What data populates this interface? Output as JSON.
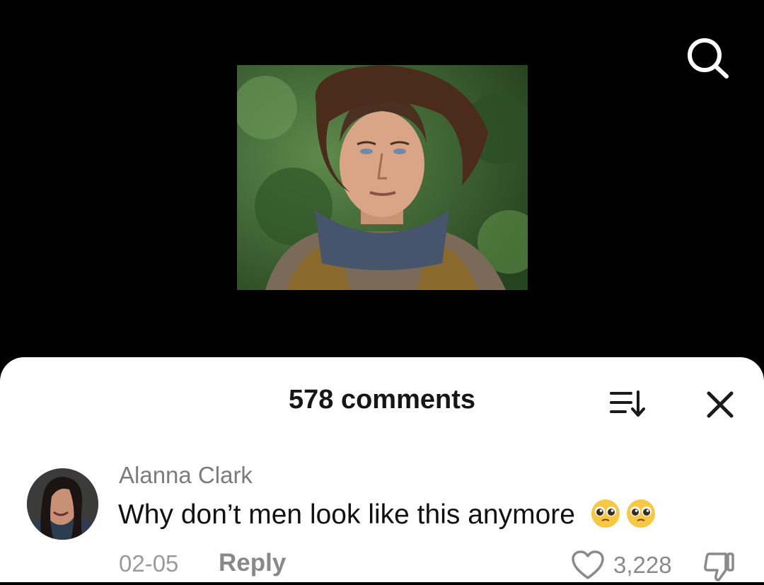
{
  "header": {
    "search_icon": "search-icon"
  },
  "video": {
    "thumbnail_desc_icon": "video-thumbnail"
  },
  "comments_sheet": {
    "title": "578 comments",
    "sort_icon": "sort-icon",
    "close_icon": "close-icon"
  },
  "comment": {
    "author": "Alanna Clark",
    "text": "Why don’t men look like this anymore",
    "emojis": [
      "pleading-face-emoji",
      "pleading-face-emoji"
    ],
    "date": "02-05",
    "reply_label": "Reply",
    "like_count": "3,228"
  },
  "colors": {
    "sheet_bg": "#ffffff",
    "screen_bg": "#000000",
    "muted_text": "#8a8a8a"
  }
}
